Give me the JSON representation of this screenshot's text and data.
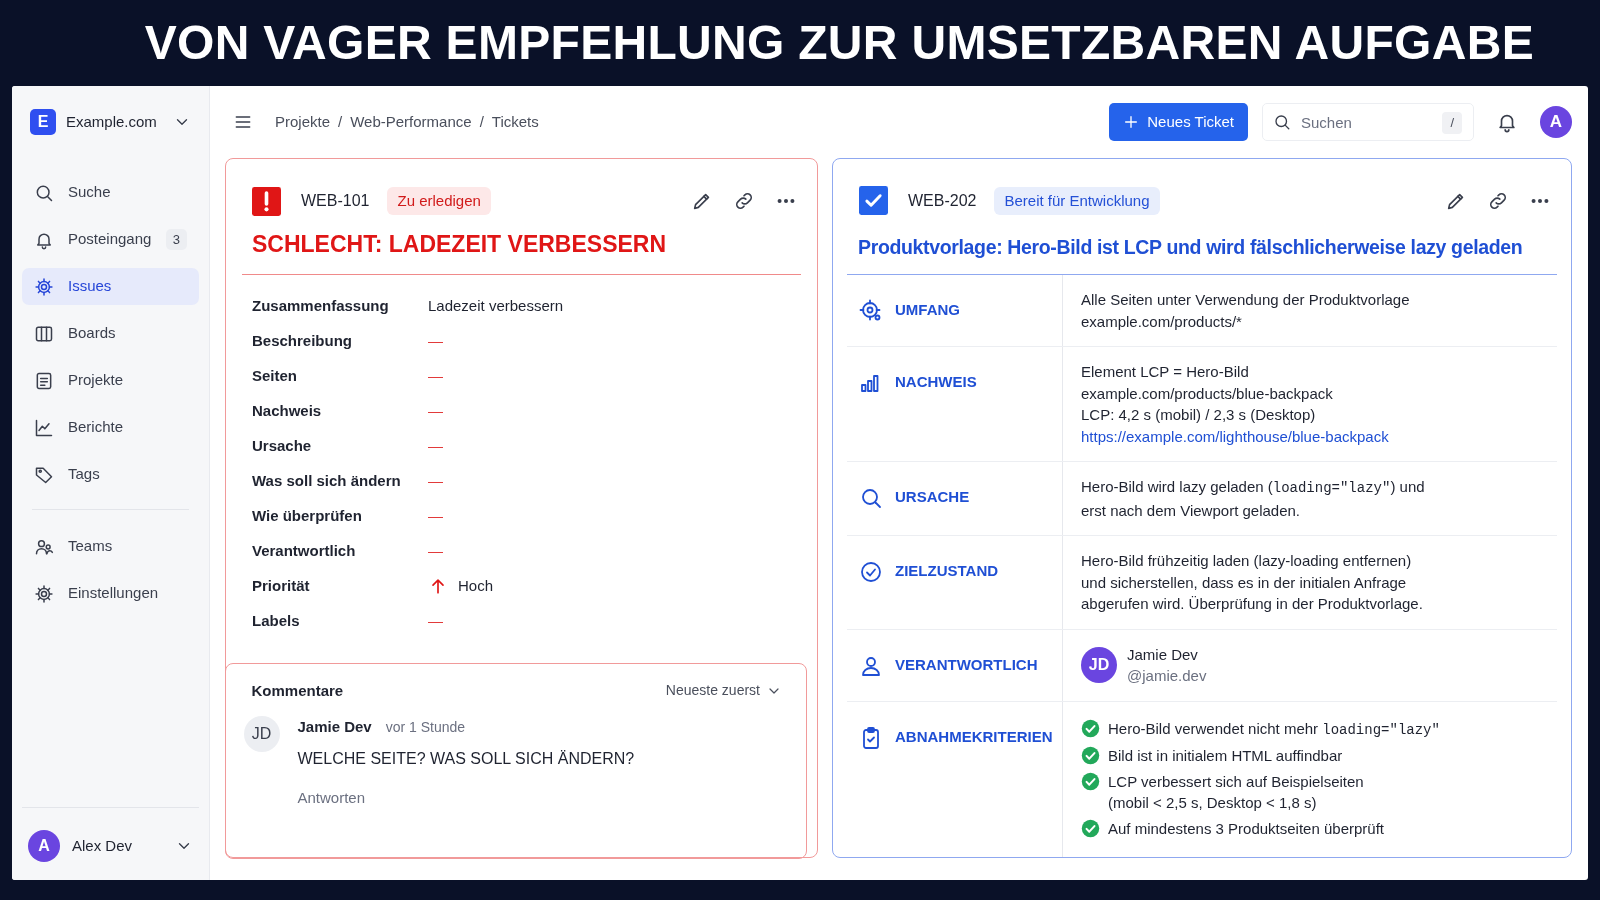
{
  "banner": {
    "title": "VON VAGER EMPFEHLUNG ZUR UMSETZBAREN AUFGABE"
  },
  "sidebar": {
    "workspace": {
      "initial": "E",
      "name": "Example.com"
    },
    "items": [
      {
        "label": "Suche",
        "selected": false
      },
      {
        "label": "Posteingang",
        "badge": "3",
        "selected": false
      },
      {
        "label": "Issues",
        "selected": true
      },
      {
        "label": "Boards",
        "selected": false
      },
      {
        "label": "Projekte",
        "selected": false
      },
      {
        "label": "Berichte",
        "selected": false
      },
      {
        "label": "Tags",
        "selected": false
      }
    ],
    "secondary_items": [
      {
        "label": "Teams",
        "selected": false
      },
      {
        "label": "Einstellungen",
        "selected": false
      }
    ],
    "user": {
      "initial": "A",
      "name": "Alex Dev"
    }
  },
  "topbar": {
    "breadcrumbs": [
      {
        "kind": "crumb",
        "text": "Projekte"
      },
      {
        "kind": "separator",
        "text": "/"
      },
      {
        "kind": "crumb",
        "text": "Web-Performance"
      },
      {
        "kind": "separator",
        "text": "/"
      },
      {
        "kind": "crumb",
        "text": "Tickets"
      }
    ],
    "new_button": "Neues Ticket",
    "search": {
      "placeholder": "Suchen",
      "shortcut": "/"
    },
    "avatar": "A"
  },
  "tickets": [
    {
      "kind": "bad",
      "id": "WEB-101",
      "status": "Zu erledigen",
      "title": "SCHLECHT: LADEZEIT VERBESSERN",
      "fields": [
        {
          "kind": "text",
          "label": "Zusammenfassung",
          "value": "Ladezeit verbessern"
        },
        {
          "kind": "missing",
          "label": "Beschreibung",
          "value": "—"
        },
        {
          "kind": "missing",
          "label": "Seiten",
          "value": "—"
        },
        {
          "kind": "missing",
          "label": "Nachweis",
          "value": "—"
        },
        {
          "kind": "missing",
          "label": "Ursache",
          "value": "—"
        },
        {
          "kind": "missing",
          "label": "Was soll sich ändern",
          "value": "—"
        },
        {
          "kind": "missing",
          "label": "Wie überprüfen",
          "value": "—"
        },
        {
          "kind": "missing",
          "label": "Verantwortlich",
          "value": "—"
        },
        {
          "kind": "priority",
          "label": "Priorität",
          "value": "Hoch"
        },
        {
          "kind": "missing",
          "label": "Labels",
          "value": "—"
        }
      ],
      "comments": {
        "title": "Kommentare",
        "sort": "Neueste zuerst",
        "items": [
          {
            "initials": "JD",
            "author": "Jamie Dev",
            "time": "vor 1 Stunde",
            "text": "WELCHE SEITE? WAS SOLL SICH ÄNDERN?",
            "reply": "Antworten"
          }
        ]
      }
    },
    {
      "kind": "good",
      "id": "WEB-202",
      "status": "Bereit für Entwicklung",
      "title": "Produktvorlage: Hero-Bild ist LCP und wird fälschlicherweise lazy geladen",
      "sections": [
        {
          "kind": "text",
          "label": "UMFANG",
          "lines": [
            [
              {
                "kind": "text",
                "text": "Alle Seiten unter Verwendung der Produktvorlage"
              }
            ],
            [
              {
                "kind": "text",
                "text": "example.com/products/*"
              }
            ]
          ]
        },
        {
          "kind": "text",
          "label": "NACHWEIS",
          "lines": [
            [
              {
                "kind": "text",
                "text": "Element LCP = Hero-Bild"
              }
            ],
            [
              {
                "kind": "text",
                "text": "example.com/products/blue-backpack"
              }
            ],
            [
              {
                "kind": "text",
                "text": "LCP: 4,2 s (mobil) / 2,3 s (Desktop)"
              }
            ],
            [
              {
                "kind": "link",
                "text": "https://example.com/lighthouse/blue-backpack"
              }
            ]
          ]
        },
        {
          "kind": "text",
          "label": "URSACHE",
          "lines": [
            [
              {
                "kind": "text",
                "text": "Hero-Bild wird lazy geladen ("
              },
              {
                "kind": "code",
                "text": "loading=\"lazy\""
              },
              {
                "kind": "text",
                "text": ") und"
              }
            ],
            [
              {
                "kind": "text",
                "text": "erst nach dem Viewport geladen."
              }
            ]
          ]
        },
        {
          "kind": "text",
          "label": "ZIELZUSTAND",
          "lines": [
            [
              {
                "kind": "text",
                "text": "Hero-Bild frühzeitig laden (lazy-loading entfernen)"
              }
            ],
            [
              {
                "kind": "text",
                "text": "und sicherstellen, dass es in der initialen Anfrage"
              }
            ],
            [
              {
                "kind": "text",
                "text": "abgerufen wird. Überprüfung in der Produktvorlage."
              }
            ]
          ]
        },
        {
          "kind": "assignee",
          "label": "VERANTWORTLICH",
          "initials": "JD",
          "name": "Jamie Dev",
          "handle": "@jamie.dev"
        },
        {
          "kind": "checklist",
          "label": "ABNAHMEKRITERIEN",
          "items": [
            {
              "checked": true,
              "lines": [
                [
                  {
                    "kind": "text",
                    "text": "Hero-Bild verwendet nicht mehr "
                  },
                  {
                    "kind": "code",
                    "text": "loading=\"lazy\""
                  }
                ]
              ]
            },
            {
              "checked": true,
              "lines": [
                [
                  {
                    "kind": "text",
                    "text": "Bild ist in initialem HTML auffindbar"
                  }
                ]
              ]
            },
            {
              "checked": true,
              "lines": [
                [
                  {
                    "kind": "text",
                    "text": "LCP verbessert sich auf Beispielseiten"
                  }
                ],
                [
                  {
                    "kind": "text",
                    "text": "(mobil < 2,5 s, Desktop < 1,8 s)"
                  }
                ]
              ]
            },
            {
              "checked": true,
              "lines": [
                [
                  {
                    "kind": "text",
                    "text": "Auf mindestens 3 Produktseiten überprüft"
                  }
                ]
              ]
            }
          ]
        }
      ]
    }
  ]
}
